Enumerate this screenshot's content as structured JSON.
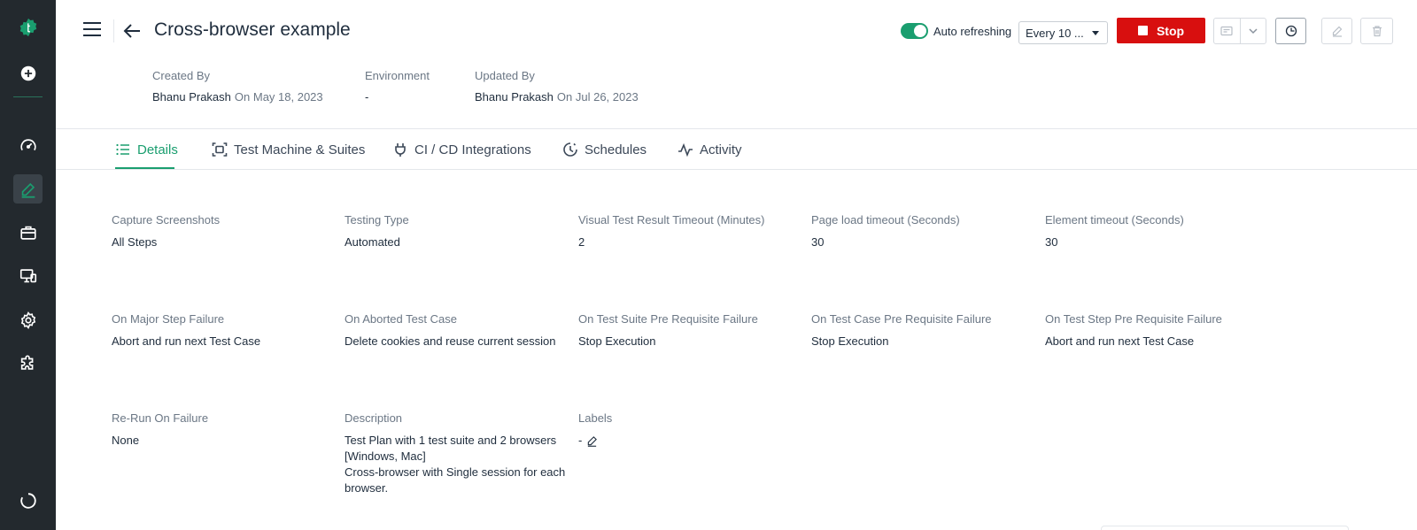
{
  "header": {
    "title": "Cross-browser example",
    "created_by_label": "Created By",
    "created_by_name": "Bhanu Prakash",
    "created_by_date": "On May 18, 2023",
    "environment_label": "Environment",
    "environment_value": "-",
    "updated_by_label": "Updated By",
    "updated_by_name": "Bhanu Prakash",
    "updated_by_date": "On Jul 26, 2023",
    "auto_refresh_label": "Auto refreshing",
    "auto_refresh_interval": "Every 10 ...",
    "stop_label": "Stop"
  },
  "tabs": [
    {
      "label": "Details"
    },
    {
      "label": "Test Machine & Suites"
    },
    {
      "label": "CI / CD Integrations"
    },
    {
      "label": "Schedules"
    },
    {
      "label": "Activity"
    }
  ],
  "details": {
    "capture_screenshots": {
      "label": "Capture Screenshots",
      "value": "All Steps"
    },
    "testing_type": {
      "label": "Testing Type",
      "value": "Automated"
    },
    "visual_timeout": {
      "label": "Visual Test Result Timeout (Minutes)",
      "value": "2"
    },
    "page_load_timeout": {
      "label": "Page load timeout (Seconds)",
      "value": "30"
    },
    "element_timeout": {
      "label": "Element timeout (Seconds)",
      "value": "30"
    },
    "major_step_failure": {
      "label": "On Major Step Failure",
      "value": "Abort and run next Test Case"
    },
    "aborted_test_case": {
      "label": "On Aborted Test Case",
      "value": "Delete cookies and reuse current session"
    },
    "suite_prereq_failure": {
      "label": "On Test Suite Pre Requisite Failure",
      "value": "Stop Execution"
    },
    "case_prereq_failure": {
      "label": "On Test Case Pre Requisite Failure",
      "value": "Stop Execution"
    },
    "step_prereq_failure": {
      "label": "On Test Step Pre Requisite Failure",
      "value": "Abort and run next Test Case"
    },
    "rerun_on_failure": {
      "label": "Re-Run On Failure",
      "value": "None"
    },
    "description": {
      "label": "Description",
      "line1": "Test Plan with 1 test suite and 2 browsers",
      "line2": "[Windows, Mac]",
      "line3": "Cross-browser with Single session for each",
      "line4": "browser."
    },
    "labels": {
      "label": "Labels",
      "value": "-"
    }
  },
  "colors": {
    "accent": "#1a9e6f",
    "stop": "#d80f0f",
    "sidebar": "#23292e"
  }
}
